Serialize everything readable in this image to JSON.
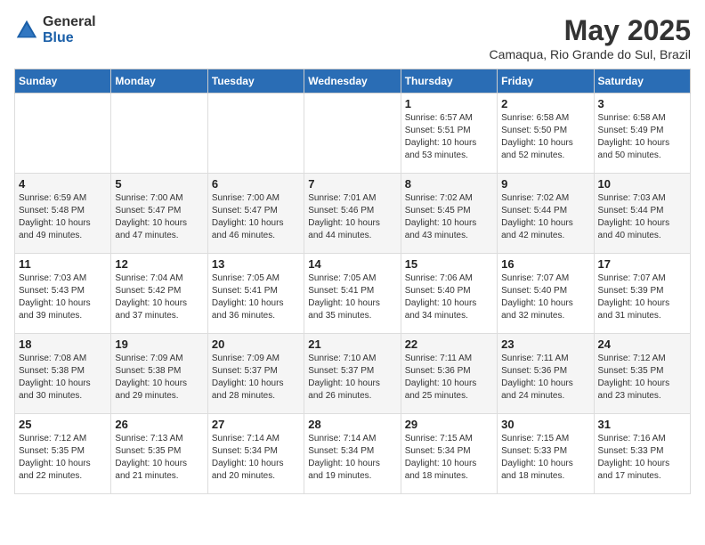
{
  "logo": {
    "text_general": "General",
    "text_blue": "Blue"
  },
  "title": "May 2025",
  "subtitle": "Camaqua, Rio Grande do Sul, Brazil",
  "days_of_week": [
    "Sunday",
    "Monday",
    "Tuesday",
    "Wednesday",
    "Thursday",
    "Friday",
    "Saturday"
  ],
  "weeks": [
    {
      "cells": [
        {
          "day": "",
          "details": ""
        },
        {
          "day": "",
          "details": ""
        },
        {
          "day": "",
          "details": ""
        },
        {
          "day": "",
          "details": ""
        },
        {
          "day": "1",
          "details": "Sunrise: 6:57 AM\nSunset: 5:51 PM\nDaylight: 10 hours\nand 53 minutes."
        },
        {
          "day": "2",
          "details": "Sunrise: 6:58 AM\nSunset: 5:50 PM\nDaylight: 10 hours\nand 52 minutes."
        },
        {
          "day": "3",
          "details": "Sunrise: 6:58 AM\nSunset: 5:49 PM\nDaylight: 10 hours\nand 50 minutes."
        }
      ]
    },
    {
      "cells": [
        {
          "day": "4",
          "details": "Sunrise: 6:59 AM\nSunset: 5:48 PM\nDaylight: 10 hours\nand 49 minutes."
        },
        {
          "day": "5",
          "details": "Sunrise: 7:00 AM\nSunset: 5:47 PM\nDaylight: 10 hours\nand 47 minutes."
        },
        {
          "day": "6",
          "details": "Sunrise: 7:00 AM\nSunset: 5:47 PM\nDaylight: 10 hours\nand 46 minutes."
        },
        {
          "day": "7",
          "details": "Sunrise: 7:01 AM\nSunset: 5:46 PM\nDaylight: 10 hours\nand 44 minutes."
        },
        {
          "day": "8",
          "details": "Sunrise: 7:02 AM\nSunset: 5:45 PM\nDaylight: 10 hours\nand 43 minutes."
        },
        {
          "day": "9",
          "details": "Sunrise: 7:02 AM\nSunset: 5:44 PM\nDaylight: 10 hours\nand 42 minutes."
        },
        {
          "day": "10",
          "details": "Sunrise: 7:03 AM\nSunset: 5:44 PM\nDaylight: 10 hours\nand 40 minutes."
        }
      ]
    },
    {
      "cells": [
        {
          "day": "11",
          "details": "Sunrise: 7:03 AM\nSunset: 5:43 PM\nDaylight: 10 hours\nand 39 minutes."
        },
        {
          "day": "12",
          "details": "Sunrise: 7:04 AM\nSunset: 5:42 PM\nDaylight: 10 hours\nand 37 minutes."
        },
        {
          "day": "13",
          "details": "Sunrise: 7:05 AM\nSunset: 5:41 PM\nDaylight: 10 hours\nand 36 minutes."
        },
        {
          "day": "14",
          "details": "Sunrise: 7:05 AM\nSunset: 5:41 PM\nDaylight: 10 hours\nand 35 minutes."
        },
        {
          "day": "15",
          "details": "Sunrise: 7:06 AM\nSunset: 5:40 PM\nDaylight: 10 hours\nand 34 minutes."
        },
        {
          "day": "16",
          "details": "Sunrise: 7:07 AM\nSunset: 5:40 PM\nDaylight: 10 hours\nand 32 minutes."
        },
        {
          "day": "17",
          "details": "Sunrise: 7:07 AM\nSunset: 5:39 PM\nDaylight: 10 hours\nand 31 minutes."
        }
      ]
    },
    {
      "cells": [
        {
          "day": "18",
          "details": "Sunrise: 7:08 AM\nSunset: 5:38 PM\nDaylight: 10 hours\nand 30 minutes."
        },
        {
          "day": "19",
          "details": "Sunrise: 7:09 AM\nSunset: 5:38 PM\nDaylight: 10 hours\nand 29 minutes."
        },
        {
          "day": "20",
          "details": "Sunrise: 7:09 AM\nSunset: 5:37 PM\nDaylight: 10 hours\nand 28 minutes."
        },
        {
          "day": "21",
          "details": "Sunrise: 7:10 AM\nSunset: 5:37 PM\nDaylight: 10 hours\nand 26 minutes."
        },
        {
          "day": "22",
          "details": "Sunrise: 7:11 AM\nSunset: 5:36 PM\nDaylight: 10 hours\nand 25 minutes."
        },
        {
          "day": "23",
          "details": "Sunrise: 7:11 AM\nSunset: 5:36 PM\nDaylight: 10 hours\nand 24 minutes."
        },
        {
          "day": "24",
          "details": "Sunrise: 7:12 AM\nSunset: 5:35 PM\nDaylight: 10 hours\nand 23 minutes."
        }
      ]
    },
    {
      "cells": [
        {
          "day": "25",
          "details": "Sunrise: 7:12 AM\nSunset: 5:35 PM\nDaylight: 10 hours\nand 22 minutes."
        },
        {
          "day": "26",
          "details": "Sunrise: 7:13 AM\nSunset: 5:35 PM\nDaylight: 10 hours\nand 21 minutes."
        },
        {
          "day": "27",
          "details": "Sunrise: 7:14 AM\nSunset: 5:34 PM\nDaylight: 10 hours\nand 20 minutes."
        },
        {
          "day": "28",
          "details": "Sunrise: 7:14 AM\nSunset: 5:34 PM\nDaylight: 10 hours\nand 19 minutes."
        },
        {
          "day": "29",
          "details": "Sunrise: 7:15 AM\nSunset: 5:34 PM\nDaylight: 10 hours\nand 18 minutes."
        },
        {
          "day": "30",
          "details": "Sunrise: 7:15 AM\nSunset: 5:33 PM\nDaylight: 10 hours\nand 18 minutes."
        },
        {
          "day": "31",
          "details": "Sunrise: 7:16 AM\nSunset: 5:33 PM\nDaylight: 10 hours\nand 17 minutes."
        }
      ]
    }
  ]
}
